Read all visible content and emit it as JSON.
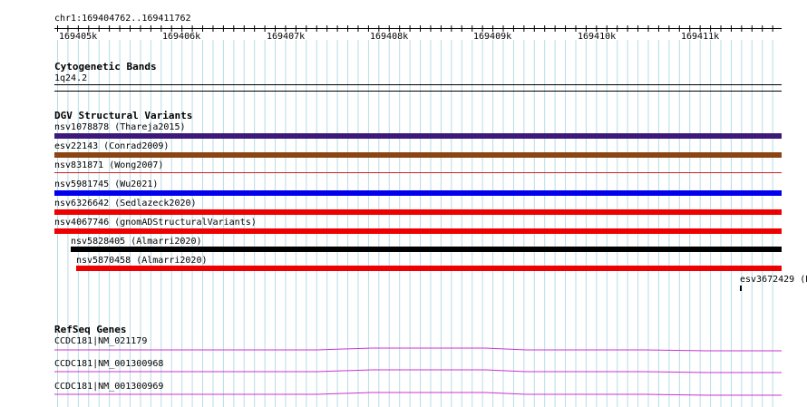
{
  "ruler": {
    "location": "chr1:169404762..169411762",
    "ticks": [
      "169405k",
      "169406k",
      "169407k",
      "169408k",
      "169409k",
      "169410k",
      "169411k"
    ]
  },
  "cytoband": {
    "title": "Cytogenetic Bands",
    "label": "1q24.2"
  },
  "dgv": {
    "title": "DGV Structural Variants",
    "features": [
      {
        "label": "nsv1078878 (Thareja2015)",
        "color": "#3d1a7a"
      },
      {
        "label": "esv22143 (Conrad2009)",
        "color": "#8b4513"
      },
      {
        "label": "nsv831871 (Wong2007)",
        "color": "#cc2222"
      },
      {
        "label": "nsv5981745 (Wu2021)",
        "color": "#0000ee"
      },
      {
        "label": "nsv6326642 (Sedlazeck2020)",
        "color": "#ee0000"
      },
      {
        "label": "nsv4067746 (gnomADStructuralVariants)",
        "color": "#ee0000"
      },
      {
        "label": "nsv5828405 (Almarri2020)",
        "color": "#000000"
      },
      {
        "label": "nsv5870458 (Almarri2020)",
        "color": "#ee0000"
      },
      {
        "label": "esv3672429 (B",
        "color": "#000000"
      }
    ]
  },
  "refseq": {
    "title": "RefSeq Genes",
    "genes": [
      {
        "label": "CCDC181|NM_021179",
        "color": "#cc33cc"
      },
      {
        "label": "CCDC181|NM_001300968",
        "color": "#cc33cc"
      },
      {
        "label": "CCDC181|NM_001300969",
        "color": "#cc33cc"
      }
    ]
  },
  "colors": {
    "gridline": "#b7dde6",
    "axis": "#000000",
    "divider": "#000000"
  }
}
